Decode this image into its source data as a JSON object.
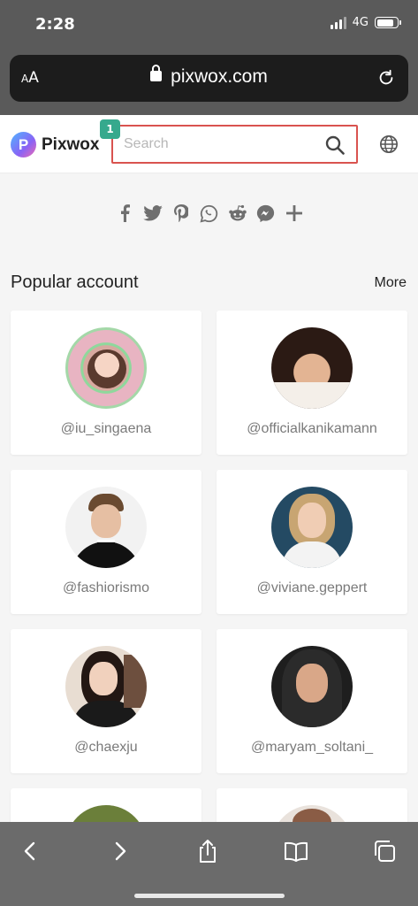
{
  "status": {
    "time": "2:28",
    "network": "4G",
    "battery_level": 0.85
  },
  "browser": {
    "aa_small": "A",
    "aa_large": "A",
    "url": "pixwox.com"
  },
  "header": {
    "logo_letter": "P",
    "logo_text": "Pixwox",
    "search_placeholder": "Search",
    "badge": "1"
  },
  "share_icons": [
    "facebook-icon",
    "twitter-icon",
    "pinterest-icon",
    "whatsapp-icon",
    "reddit-icon",
    "messenger-icon",
    "plus-icon"
  ],
  "popular": {
    "title": "Popular account",
    "more": "More",
    "accounts": [
      {
        "handle": "@iu_singaena"
      },
      {
        "handle": "@officialkanikamann"
      },
      {
        "handle": "@fashiorismo"
      },
      {
        "handle": "@viviane.geppert"
      },
      {
        "handle": "@chaexju"
      },
      {
        "handle": "@maryam_soltani_"
      },
      {
        "handle": ""
      },
      {
        "handle": ""
      }
    ]
  },
  "colors": {
    "accent_red": "#d9534f",
    "badge_green": "#36a98d",
    "chrome": "#5a5a5a"
  }
}
